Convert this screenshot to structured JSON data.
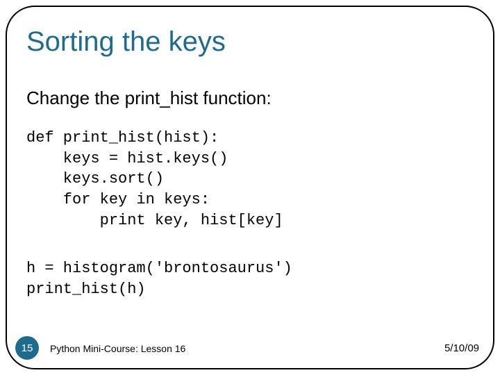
{
  "title": "Sorting the keys",
  "subtitle": "Change the print_hist function:",
  "code1": "def print_hist(hist):\n    keys = hist.keys()\n    keys.sort()\n    for key in keys:\n        print key, hist[key]",
  "code2": "h = histogram('brontosaurus')\nprint_hist(h)",
  "footer": {
    "slide_number": "15",
    "course": "Python Mini-Course: Lesson 16",
    "date": "5/10/09"
  }
}
